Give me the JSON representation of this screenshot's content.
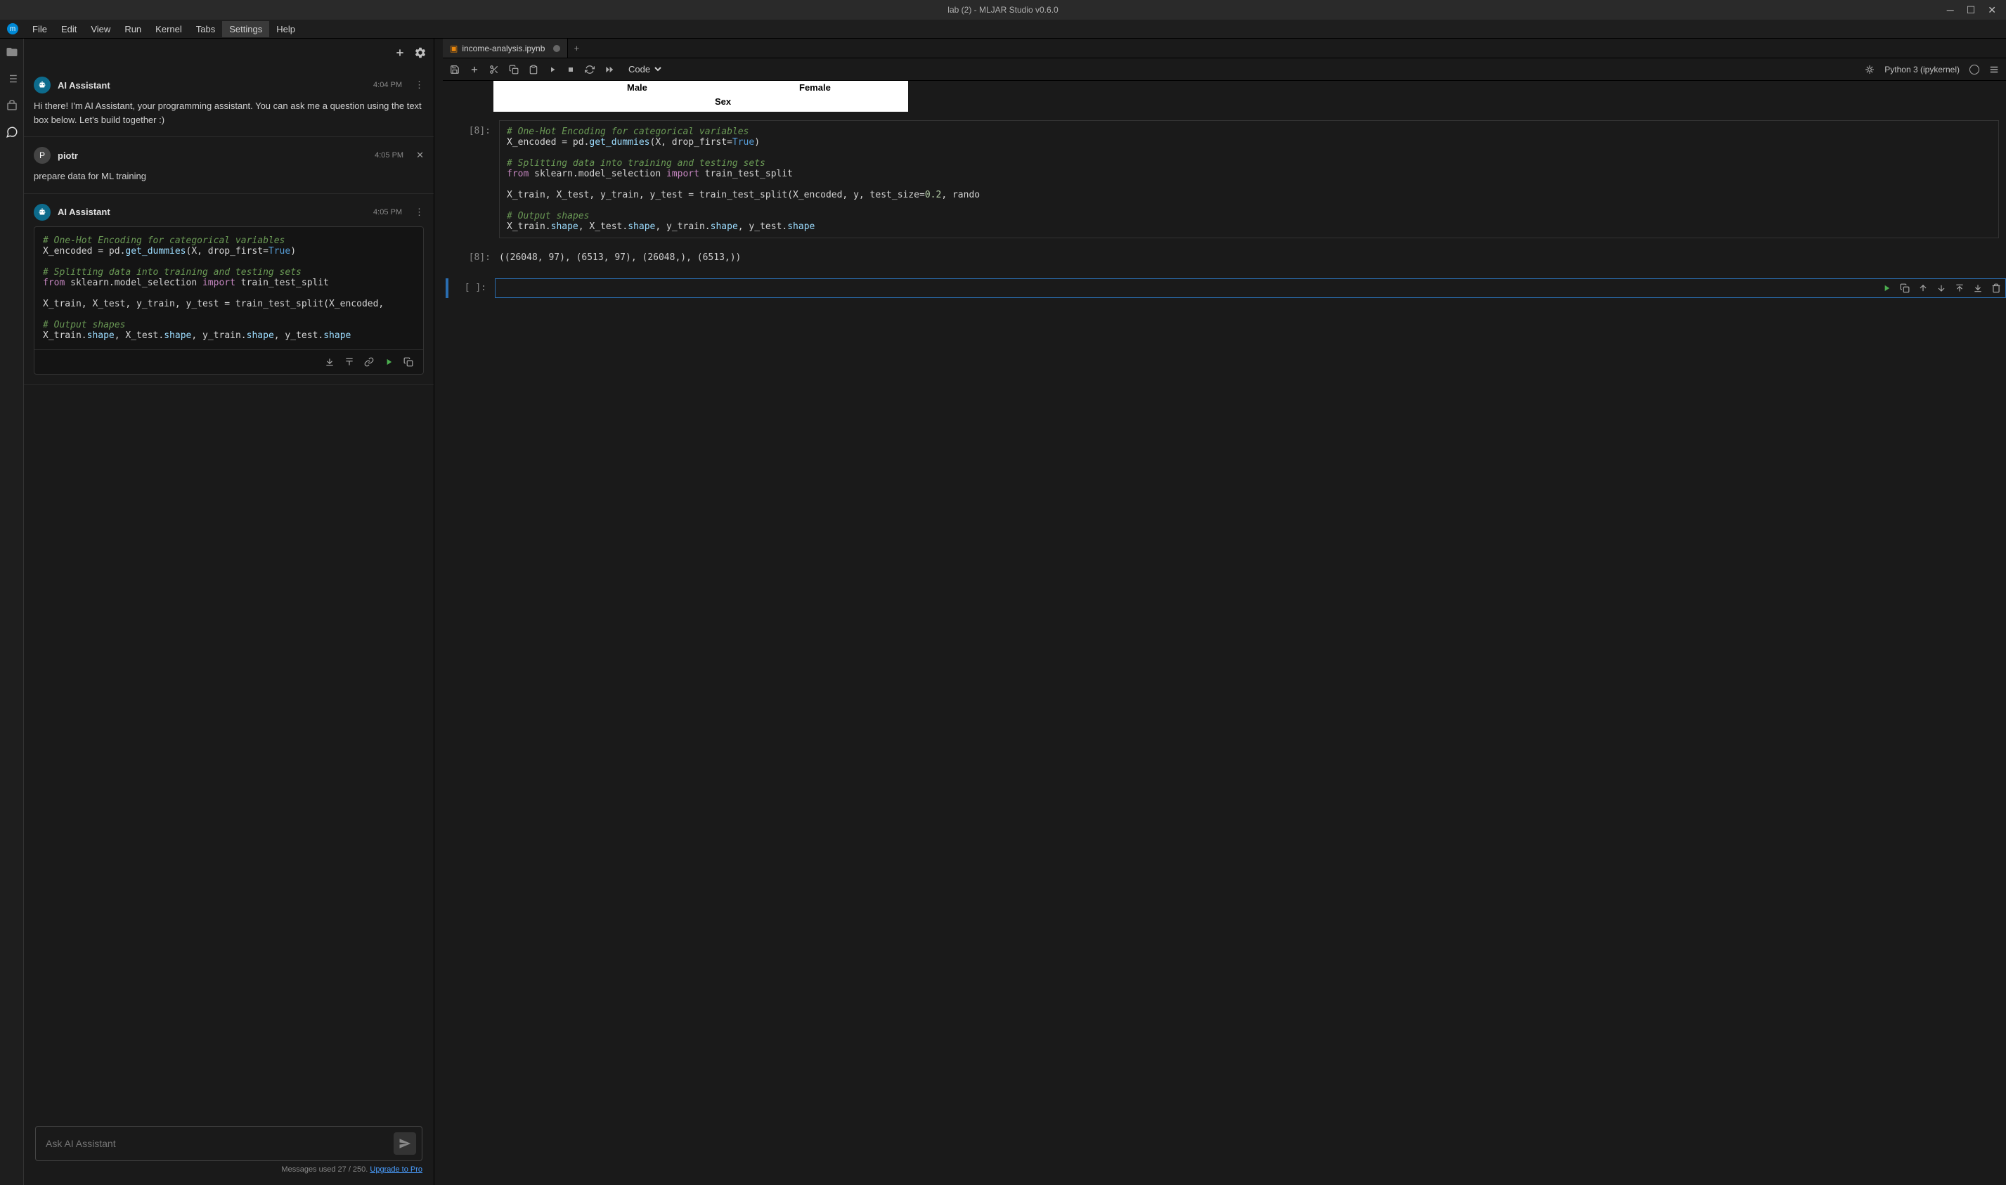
{
  "window": {
    "title": "lab (2) - MLJAR Studio v0.6.0"
  },
  "menu": [
    "File",
    "Edit",
    "View",
    "Run",
    "Kernel",
    "Tabs",
    "Settings",
    "Help"
  ],
  "menu_active": 6,
  "chat": {
    "messages": [
      {
        "sender": "AI Assistant",
        "time": "4:04 PM",
        "body": "Hi there! I'm AI Assistant, your programming assistant. You can ask me a question using the text box below. Let's build together :)",
        "avatar": "ai"
      },
      {
        "sender": "piotr",
        "time": "4:05 PM",
        "body": "prepare data for ML training",
        "avatar": "user",
        "closable": true
      },
      {
        "sender": "AI Assistant",
        "time": "4:05 PM",
        "avatar": "ai",
        "code": true
      }
    ],
    "code": {
      "l1": "# One-Hot Encoding for categorical variables",
      "l2a": "X_encoded = pd.",
      "l2b": "get_dummies",
      "l2c": "(X, drop_first=",
      "l2d": "True",
      "l2e": ")",
      "l3": "# Splitting data into training and testing sets",
      "l4a": "from",
      "l4b": " sklearn.model_selection ",
      "l4c": "import",
      "l4d": " train_test_split",
      "l5": "X_train, X_test, y_train, y_test = train_test_split(X_encoded, ",
      "l6": "# Output shapes",
      "l7a": "X_train.",
      "l7b": "shape",
      "l7c": ", X_test.",
      "l7d": "shape",
      "l7e": ", y_train.",
      "l7f": "shape",
      "l7g": ", y_test.",
      "l7h": "shape"
    },
    "input_placeholder": "Ask AI Assistant",
    "usage_text": "Messages used 27 / 250. ",
    "upgrade": "Upgrade to Pro"
  },
  "notebook": {
    "tab": "income-analysis.ipynb",
    "toolbar_select": "Code",
    "kernel": "Python 3 (ipykernel)",
    "chart": {
      "male": "Male",
      "female": "Female",
      "axis": "Sex"
    },
    "cell8": {
      "prompt": "[8]:",
      "l1": "# One-Hot Encoding for categorical variables",
      "l2a": "X_encoded = pd.",
      "l2b": "get_dummies",
      "l2c": "(X, drop_first=",
      "l2d": "True",
      "l2e": ")",
      "l3": "# Splitting data into training and testing sets",
      "l4a": "from",
      "l4b": " sklearn.model_selection ",
      "l4c": "import",
      "l4d": " train_test_split",
      "l5a": "X_train, X_test, y_train, y_test = train_test_split(X_encoded, y, test_size=",
      "l5b": "0.2",
      "l5c": ", rando",
      "l6": "# Output shapes",
      "l7a": "X_train.",
      "l7b": "shape",
      "l7c": ", X_test.",
      "l7d": "shape",
      "l7e": ", y_train.",
      "l7f": "shape",
      "l7g": ", y_test.",
      "l7h": "shape",
      "out_prompt": "[8]:",
      "output": "((26048, 97), (6513, 97), (26048,), (6513,))"
    },
    "empty_prompt": "[ ]:"
  }
}
